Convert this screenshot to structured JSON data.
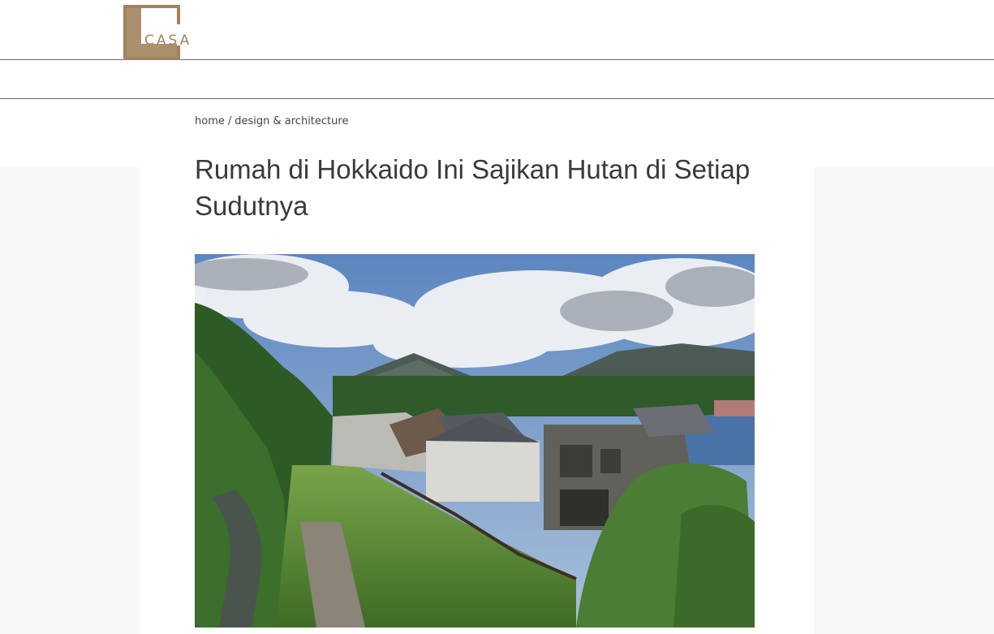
{
  "header": {
    "logo_text": "CASA"
  },
  "breadcrumb": {
    "home": "home",
    "separator": "/",
    "category": "design & architecture"
  },
  "article": {
    "title": "Rumah di Hokkaido Ini Sajikan Hutan di Setiap Sudutnya"
  },
  "colors": {
    "brand": "#a2835f",
    "rule": "#6b6b6b",
    "side_background": "#f8f8f8"
  }
}
